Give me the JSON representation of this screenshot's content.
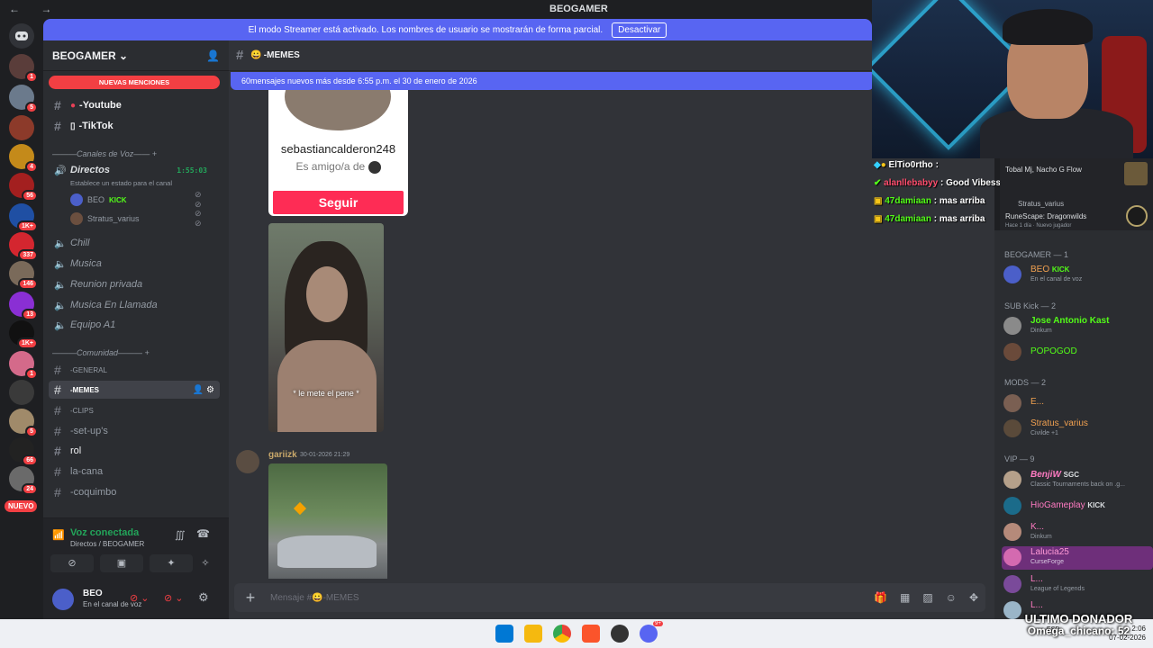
{
  "window": {
    "nav_arrows": "← →",
    "title": "BEOGAMER"
  },
  "banner": {
    "text": "El modo Streamer está activado. Los nombres de usuario se mostrarán de forma parcial.",
    "button": "Desactivar"
  },
  "rail": {
    "servers": [
      {
        "badge": ""
      },
      {
        "badge": "1"
      },
      {
        "badge": "5"
      },
      {
        "badge": ""
      },
      {
        "badge": "4"
      },
      {
        "badge": "56"
      },
      {
        "badge": "1K+"
      },
      {
        "badge": "337"
      },
      {
        "badge": "146"
      },
      {
        "badge": "13"
      },
      {
        "badge": "1K+"
      },
      {
        "badge": "1"
      },
      {
        "badge": ""
      },
      {
        "badge": "5"
      },
      {
        "badge": "66"
      },
      {
        "badge": "24"
      }
    ],
    "new_label": "NUEVO"
  },
  "sidebar": {
    "guild_name": "BEOGAMER",
    "mentions_label": "NUEVAS MENCIONES",
    "channels_top": [
      {
        "name": "-Youtube"
      },
      {
        "name": "-TikTok"
      }
    ],
    "cat_voice": "Canales de Voz",
    "directos": {
      "name": "Directos",
      "timer": "1:55:03",
      "status": "Establece un estado para el canal"
    },
    "voice_users": [
      {
        "name": "BEO",
        "tag": "KICK"
      },
      {
        "name": "Stratus_varius",
        "tag": ""
      }
    ],
    "voice_channels": [
      {
        "name": "Chill"
      },
      {
        "name": "Musica"
      },
      {
        "name": "Reunion privada"
      },
      {
        "name": "Musica En Llamada"
      },
      {
        "name": "Equipo A1"
      }
    ],
    "cat_comunidad": "Comunidad",
    "text_channels": [
      {
        "name": "-GENERAL"
      },
      {
        "name": "-MEMES"
      },
      {
        "name": "-CLIPS"
      },
      {
        "name": "-set-up's"
      },
      {
        "name": "rol"
      },
      {
        "name": "la-cana"
      },
      {
        "name": "-coquimbo"
      }
    ],
    "voice_panel": {
      "status": "Voz conectada",
      "location": "Directos / BEOGAMER"
    },
    "user": {
      "name": "BEO",
      "status": "En el canal de voz"
    }
  },
  "chat": {
    "channel": "-MEMES",
    "new_messages_bar": "60mensajes nuevos más desde 6:55 p.m. el 30 de enero de 2026",
    "embed": {
      "username": "sebastiancalderon248",
      "friend_text": "Es amigo/a de",
      "follow_button": "Seguir"
    },
    "photo_caption": "* le mete el pene *",
    "message": {
      "author": "gariizk",
      "time": "30-01-2026 21:29"
    },
    "composer_placeholder": "Mensaje #😀-MEMES"
  },
  "stream_chat": [
    {
      "user": "ElTio0rtho",
      "text": ":",
      "color": "#ffffff"
    },
    {
      "user": "alanllebabyy",
      "text": ": Good Vibess & Big Dubss LFG!!!!",
      "color": "#ff4d6d"
    },
    {
      "user": "47damiaan",
      "text": ": mas arriba",
      "color": "#53fc18"
    },
    {
      "user": "47damiaan",
      "text": ": mas arriba",
      "color": "#53fc18"
    }
  ],
  "activity": {
    "line1": "Tobal Mj, Nacho G Flow",
    "line2": "Stratus_varius",
    "line3": "RuneScape: Dragonwilds",
    "line4": "Hace 1 día  ·  Nuevo jugador"
  },
  "members": {
    "groups": [
      {
        "title": "BEOGAMER — 1"
      },
      {
        "title": "SUB Kick — 2"
      },
      {
        "title": "MODS — 2"
      },
      {
        "title": "VIP — 9"
      }
    ],
    "list": [
      {
        "name": "BEO",
        "tag": "KICK",
        "sub": "En el canal de voz",
        "color": "#f0a050"
      },
      {
        "name": "Jose Antonio Kast",
        "tag": "",
        "sub": "Dinkum",
        "color": "#53fc18"
      },
      {
        "name": "POPOGOD",
        "tag": "",
        "sub": "",
        "color": "#53fc18"
      },
      {
        "name": "E...",
        "tag": "",
        "sub": "",
        "color": "#f0a050"
      },
      {
        "name": "Stratus_varius",
        "tag": "",
        "sub": "Civilde +1",
        "color": "#f0a050"
      },
      {
        "name": "BenjiW",
        "tag": "SGC",
        "sub": "Classic Tournaments back on .g...",
        "color": "#ff7ac2"
      },
      {
        "name": "HioGameplay",
        "tag": "KICK",
        "sub": "",
        "color": "#ff7ac2"
      },
      {
        "name": "K...",
        "tag": "",
        "sub": "Dinkum",
        "color": "#ff7ac2"
      },
      {
        "name": "Lalucia25",
        "tag": "",
        "sub": "CurseForge",
        "color": "#ff7ac2"
      },
      {
        "name": "L...",
        "tag": "",
        "sub": "League of Legends",
        "color": "#ff7ac2"
      },
      {
        "name": "L...",
        "tag": "",
        "sub": "",
        "color": "#ff7ac2"
      }
    ]
  },
  "donor": {
    "title": "ULTIMO DONADOR",
    "name": "Omega_chicano: 52"
  },
  "taskbar": {
    "lang": "ESP",
    "time": "2:06",
    "date": "07-02-2026",
    "discord_badge": "9+"
  }
}
